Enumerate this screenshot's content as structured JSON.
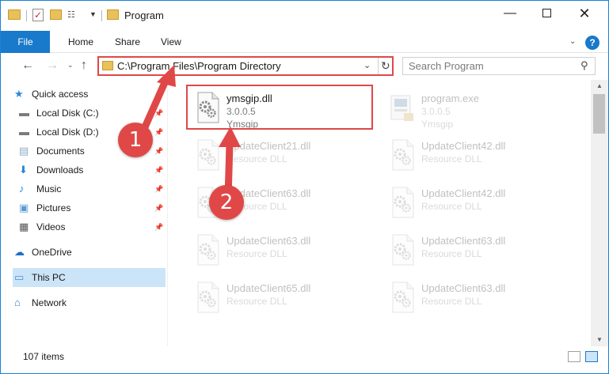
{
  "window": {
    "title": "Program",
    "controls": {
      "minimize": "—",
      "close": "✕"
    }
  },
  "ribbon": {
    "tabs": {
      "file": "File",
      "home": "Home",
      "share": "Share",
      "view": "View"
    },
    "help": "?"
  },
  "navigation": {
    "address": "C:\\Program Files\\Program Directory",
    "search_placeholder": "Search Program"
  },
  "sidebar": {
    "items": [
      {
        "label": "Quick access",
        "icon": "star-icon",
        "pinned": false
      },
      {
        "label": "Local Disk (C:)",
        "icon": "drive-icon",
        "pinned": true
      },
      {
        "label": "Local Disk (D:)",
        "icon": "drive-icon",
        "pinned": true
      },
      {
        "label": "Documents",
        "icon": "documents-icon",
        "pinned": true
      },
      {
        "label": "Downloads",
        "icon": "download-icon",
        "pinned": true
      },
      {
        "label": "Music",
        "icon": "music-icon",
        "pinned": true
      },
      {
        "label": "Pictures",
        "icon": "pictures-icon",
        "pinned": true
      },
      {
        "label": "Videos",
        "icon": "videos-icon",
        "pinned": true
      },
      {
        "label": "OneDrive",
        "icon": "cloud-icon",
        "pinned": false
      },
      {
        "label": "This PC",
        "icon": "computer-icon",
        "pinned": false,
        "selected": true
      },
      {
        "label": "Network",
        "icon": "network-icon",
        "pinned": false
      }
    ]
  },
  "files": [
    {
      "name": "ymsgip.dll",
      "line1": "3.0.0.5",
      "line2": "Ymsgip",
      "type": "dll",
      "highlighted": true
    },
    {
      "name": "program.exe",
      "line1": "3.0.0.5",
      "line2": "Ymsgip",
      "type": "exe"
    },
    {
      "name": "UpdateClient21.dll",
      "line1": "Resource DLL",
      "line2": "",
      "type": "dll"
    },
    {
      "name": "UpdateClient42.dll",
      "line1": "Resource DLL",
      "line2": "",
      "type": "dll"
    },
    {
      "name": "UpdateClient63.dll",
      "line1": "Resource DLL",
      "line2": "",
      "type": "dll"
    },
    {
      "name": "UpdateClient42.dll",
      "line1": "Resource DLL",
      "line2": "",
      "type": "dll"
    },
    {
      "name": "UpdateClient63.dll",
      "line1": "Resource DLL",
      "line2": "",
      "type": "dll"
    },
    {
      "name": "UpdateClient63.dll",
      "line1": "Resource DLL",
      "line2": "",
      "type": "dll"
    },
    {
      "name": "UpdateClient65.dll",
      "line1": "Resource DLL",
      "line2": "",
      "type": "dll"
    },
    {
      "name": "UpdateClient63.dll",
      "line1": "Resource DLL",
      "line2": "",
      "type": "dll"
    }
  ],
  "status": {
    "item_count": "107 items"
  },
  "annotations": {
    "step1": "1",
    "step2": "2",
    "color": "#e04848"
  }
}
